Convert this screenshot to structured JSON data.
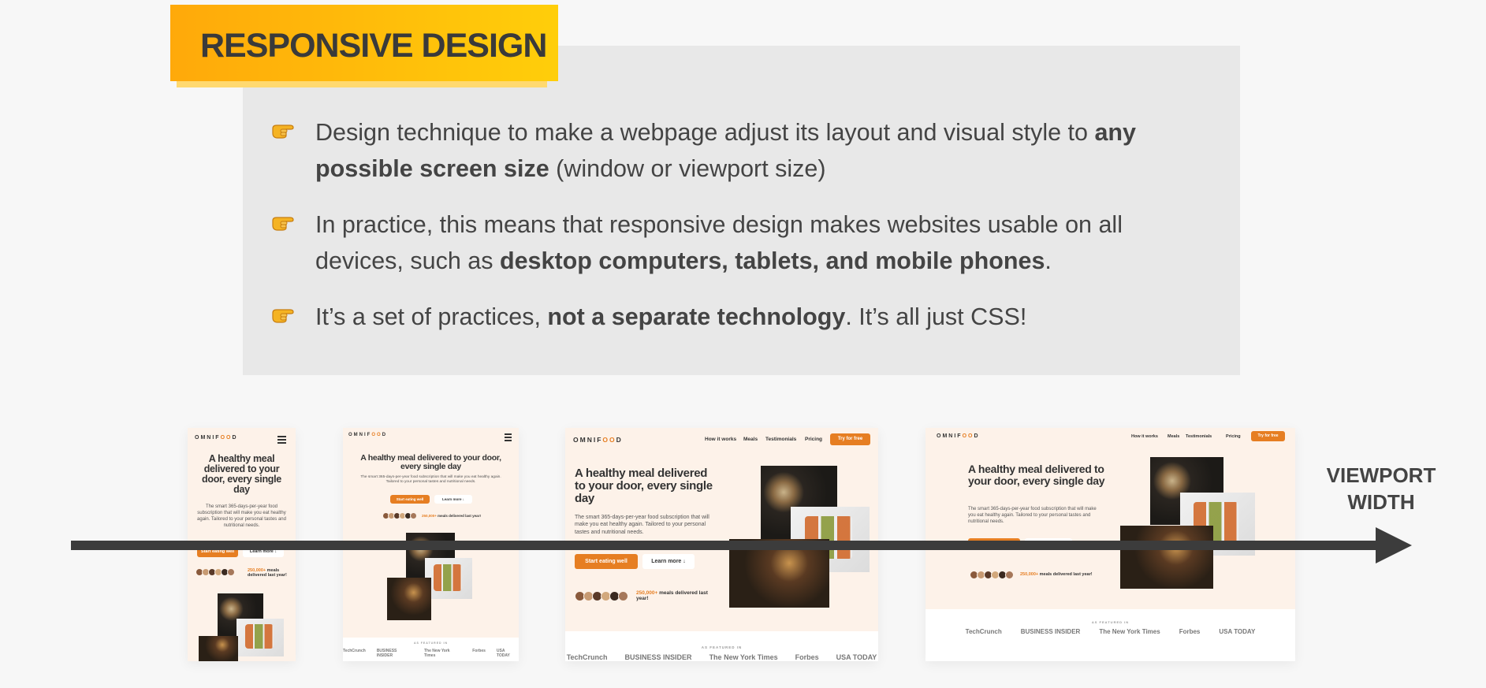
{
  "title": "RESPONSIVE DESIGN",
  "bullets": [
    {
      "t1": "Design technique to make a webpage adjust its layout and visual style to ",
      "b1": "any possible screen size",
      "t2": " (window or viewport size)",
      "b2": "",
      "t3": ""
    },
    {
      "t1": "In practice, this means that responsive design makes websites usable on all devices, such as ",
      "b1": "desktop computers, tablets, and mobile phones",
      "t2": ".",
      "b2": "",
      "t3": ""
    },
    {
      "t1": "It’s a set of practices, ",
      "b1": "not a separate technology",
      "t2": ". It’s all just CSS!",
      "b2": "",
      "t3": ""
    }
  ],
  "icons": {
    "bullet": "pointing-hand-icon",
    "menu": "hamburger-menu-icon",
    "arrow": "arrow-right-icon"
  },
  "colors": {
    "accent": "#e67e22",
    "badge_start": "#ffa90a",
    "badge_end": "#ffce0a",
    "mock_bg": "#fdf2e9"
  },
  "arrow_label": "VIEWPORT\nWIDTH",
  "mock": {
    "logo_a": "OMNIF",
    "logo_b": "OO",
    "logo_c": "D",
    "headline": "A healthy meal delivered to your door, every single day",
    "description": "The smart 365-days-per-year food subscription that will make you eat healthy again. Tailored to your personal tastes and nutritional needs.",
    "cta_primary": "Start eating well",
    "cta_secondary": "Learn more ↓",
    "stat_number": "250,000+",
    "stat_text": " meals delivered last year!",
    "nav": [
      "How it works",
      "Meals",
      "Testimonials",
      "Pricing"
    ],
    "nav_cta": "Try for free",
    "featured": "AS FEATURED IN",
    "brands": [
      "TechCrunch",
      "BUSINESS INSIDER",
      "The New York Times",
      "Forbes",
      "USA TODAY"
    ]
  }
}
